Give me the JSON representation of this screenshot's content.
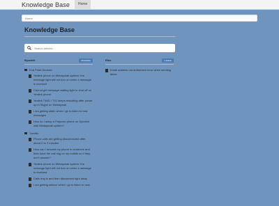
{
  "nav": {
    "brand": "Knowledge Base",
    "home_tab": "Home"
  },
  "breadcrumb": "Home",
  "page_title": "Knowledge Base",
  "search": {
    "placeholder": "Search articles..."
  },
  "columns": [
    {
      "title": "Bysaleti",
      "badge": "49 Articles",
      "folders": [
        {
          "name": "End Point Devices",
          "articles": [
            "Yealink phone on Metaspeak system; the message light will not turn on when a message is received",
            "Cannot get message waiting light to shut off on Yealink phone",
            "Yealink T46G / T41 keeps restarting after power up in Skype on Metaspeak",
            "I am getting static when I go to listen to new messages",
            "How do I setup a Polycom phone on Sylvoice with Metaspeak system?"
          ]
        },
        {
          "name": "Tzevllic",
          "articles": [
            "Phone calls are getting disconnected after about 2 to 3 minutes",
            "How can I forward my phone to someone and then have the call ring on my mobile so if they don't answer?",
            "Yealink phone on Metaspeak system; the message light will not turn on when a message is received",
            "Calls ring in and then disconnect right away",
            "I am getting silence when I go to listen to new"
          ]
        }
      ]
    },
    {
      "title": "Efax",
      "badge": "1 Article",
      "folders": [
        {
          "name": "",
          "articles": [
            "Email address not authorized error when sending faxes"
          ]
        }
      ]
    }
  ]
}
